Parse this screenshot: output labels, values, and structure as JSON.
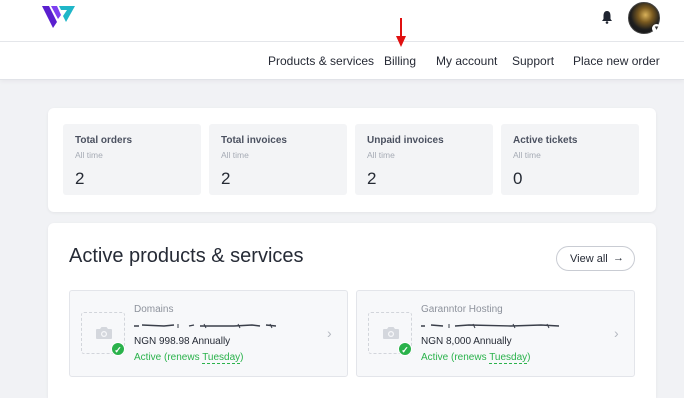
{
  "nav": {
    "items": [
      "Products & services",
      "Billing",
      "My account",
      "Support",
      "Place new order"
    ]
  },
  "stats": [
    {
      "title": "Total orders",
      "sub": "All time",
      "value": "2"
    },
    {
      "title": "Total invoices",
      "sub": "All time",
      "value": "2"
    },
    {
      "title": "Unpaid invoices",
      "sub": "All time",
      "value": "2"
    },
    {
      "title": "Active tickets",
      "sub": "All time",
      "value": "0"
    }
  ],
  "products": {
    "title": "Active products & services",
    "view_all": "View all",
    "view_all_icon": "→",
    "items": [
      {
        "category": "Domains",
        "price": "NGN 998.98 Annually",
        "status_prefix": "Active (renews ",
        "status_day": "Tuesday",
        "status_suffix": ")"
      },
      {
        "category": "Garanntor Hosting",
        "price": "NGN 8,000 Annually",
        "status_prefix": "Active (renews ",
        "status_day": "Tuesday",
        "status_suffix": ")"
      }
    ]
  },
  "icons": {
    "logo": "brand-logo",
    "bell": "bell-icon",
    "caret": "chevron-down-icon",
    "camera": "camera-icon",
    "check": "check-icon",
    "chevron": "chevron-right-icon"
  },
  "colors": {
    "accent_purple": "#6b2bd9",
    "accent_teal": "#1fb6c8",
    "status_green": "#2ab24b",
    "annotation_red": "#e01010"
  }
}
